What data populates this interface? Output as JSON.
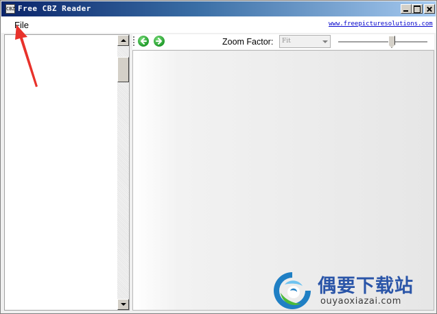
{
  "window": {
    "title": "Free CBZ Reader",
    "icon_text": "CBZ"
  },
  "menu": {
    "file_label": "File",
    "site_link": "www.freepicturesolutions.com"
  },
  "toolbar": {
    "zoom_label": "Zoom Factor:",
    "zoom_value": "Fit",
    "zoom_slider_level": 0.6
  },
  "watermark": {
    "name_cn": "偶要下载站",
    "url": "ouyaoxiazai.com"
  },
  "colors": {
    "title_bar": "#0a246a",
    "annotation_arrow": "#e8322b",
    "nav_buttons": "#1f9a2a",
    "watermark_text": "#2a55a8"
  },
  "icons": [
    "app-icon",
    "minimize-icon",
    "maximize-icon",
    "close-icon",
    "back-arrow-icon",
    "forward-arrow-icon",
    "scroll-up-icon",
    "scroll-down-icon",
    "dropdown-arrow-icon",
    "annotation-arrow"
  ]
}
